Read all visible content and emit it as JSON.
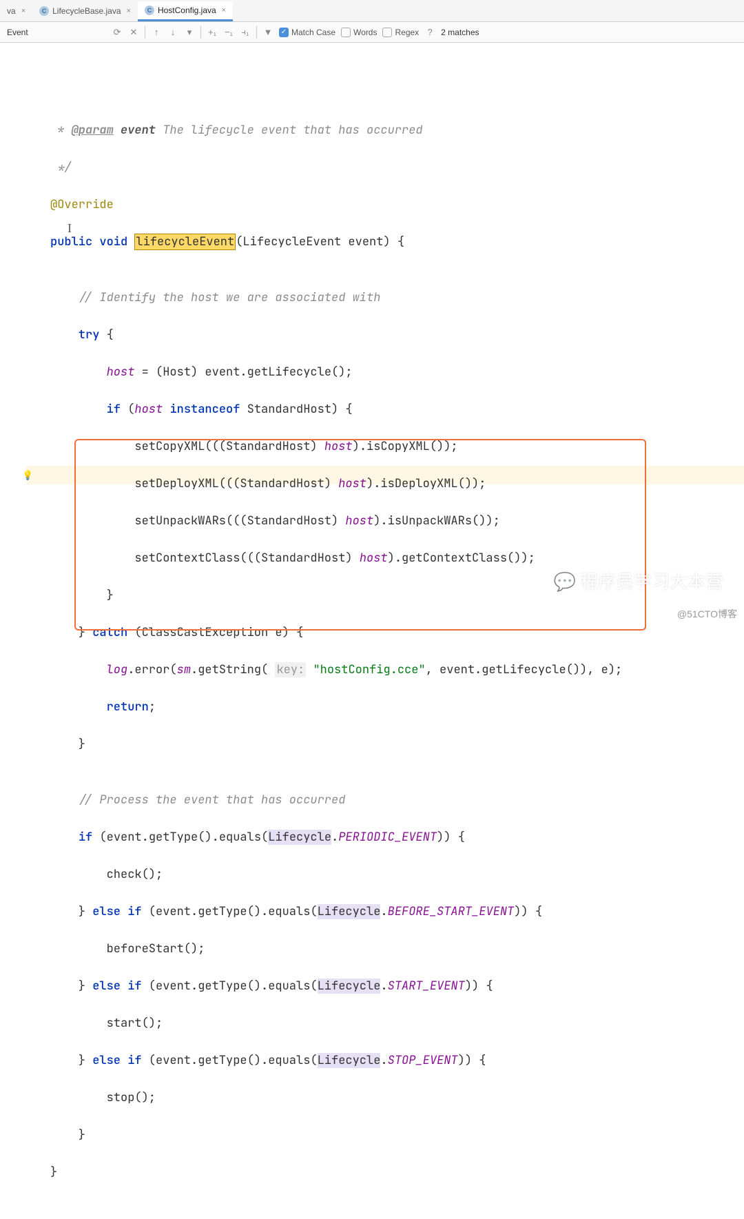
{
  "tabs": [
    {
      "icon": "C",
      "label": "va",
      "close": "×",
      "active": false,
      "partial": true
    },
    {
      "icon": "C",
      "label": "LifecycleBase.java",
      "close": "×",
      "active": false
    },
    {
      "icon": "C",
      "label": "HostConfig.java",
      "close": "×",
      "active": true
    }
  ],
  "find": {
    "input_value": "Event",
    "history_icon": "⟳",
    "close_icon": "✕",
    "prev_icon": "↑",
    "next_icon": "↓",
    "filter_icon": "▾",
    "add_sel_icon": "+₁",
    "sel_all_icon": "−₁",
    "remove_icon": "⫞₁",
    "funnel_icon": "▼",
    "match_case": {
      "label": "Match Case",
      "checked": true,
      "glyph": "✓"
    },
    "words": {
      "label": "Words",
      "checked": false
    },
    "regex": {
      "label": "Regex",
      "checked": false
    },
    "help_icon": "?",
    "matches": "2 matches"
  },
  "code": {
    "l1a": " * ",
    "l1_tag": "@param",
    "l1_pn": " event ",
    "l1b": "The lifecycle event that has occurred",
    "l2": " */",
    "l3": "@Override",
    "l4_pub": "public ",
    "l4_void": "void ",
    "l4_m": "lifecycleEvent",
    "l4_sig": "(LifecycleEvent event) {",
    "l5": "",
    "l6": "    // Identify the host we are associated with",
    "l7_try": "    try ",
    "l7b": "{",
    "l8a": "        ",
    "l8_host": "host",
    "l8b": " = (Host) event.getLifecycle();",
    "l9a": "        ",
    "l9_if": "if ",
    "l9b": "(",
    "l9_host": "host",
    "l9_sp": " ",
    "l9_inst": "instanceof",
    "l9c": " StandardHost) {",
    "l10a": "            setCopyXML(((StandardHost) ",
    "l10_host": "host",
    "l10b": ").isCopyXML());",
    "l11a": "            setDeployXML(((StandardHost) ",
    "l11_host": "host",
    "l11b": ").isDeployXML());",
    "l12a": "            setUnpackWARs(((StandardHost) ",
    "l12_host": "host",
    "l12b": ").isUnpackWARs());",
    "l13a": "            setContextClass(((StandardHost) ",
    "l13_host": "host",
    "l13b": ").getContextClass());",
    "l14": "        }",
    "l15a": "    } ",
    "l15_catch": "catch",
    "l15b": " (ClassCastException e) {",
    "l16a": "        ",
    "l16_log": "log",
    "l16b": ".error(",
    "l16_sm": "sm",
    "l16c": ".getString( ",
    "l16_hint": "key:",
    "l16_sp": " ",
    "l16_str": "\"hostConfig.cce\"",
    "l16d": ", event.getLifecycle()), e);",
    "l17a": "        ",
    "l17_ret": "return",
    "l17b": ";",
    "l18": "    }",
    "l19": "",
    "l20": "    // Process the event that has occurred",
    "l21a": "    ",
    "l21_if": "if",
    "l21b": " (event.getType().equals(",
    "l21_lc": "Lifecycle",
    "l21c": ".",
    "l21_ev": "PERIODIC_EVENT",
    "l21d": ")) {",
    "l22": "        check();",
    "l23a": "    } ",
    "l23_else": "else if",
    "l23b": " (event.getType().equals(",
    "l23_lc": "Lifecycle",
    "l23c": ".",
    "l23_ev": "BEFORE_START_EVENT",
    "l23d": ")) {",
    "l24": "        beforeStart();",
    "l25a": "    } ",
    "l25_else": "else if",
    "l25b": " (event.getType().equals(",
    "l25_lc": "Lifecycle",
    "l25c": ".",
    "l25_ev": "START_EVENT",
    "l25d": ")) {",
    "l26": "        start();",
    "l27a": "    } ",
    "l27_else": "else if",
    "l27b": " (event.getType().equals(",
    "l27_lc": "Lifecycle",
    "l27c": ".",
    "l27_ev": "STOP_EVENT",
    "l27d": ")) {",
    "l28": "        stop();",
    "l29": "    }",
    "l30": "}"
  },
  "watermark1": "程序员学习大本营",
  "watermark2": "@51CTO博客"
}
